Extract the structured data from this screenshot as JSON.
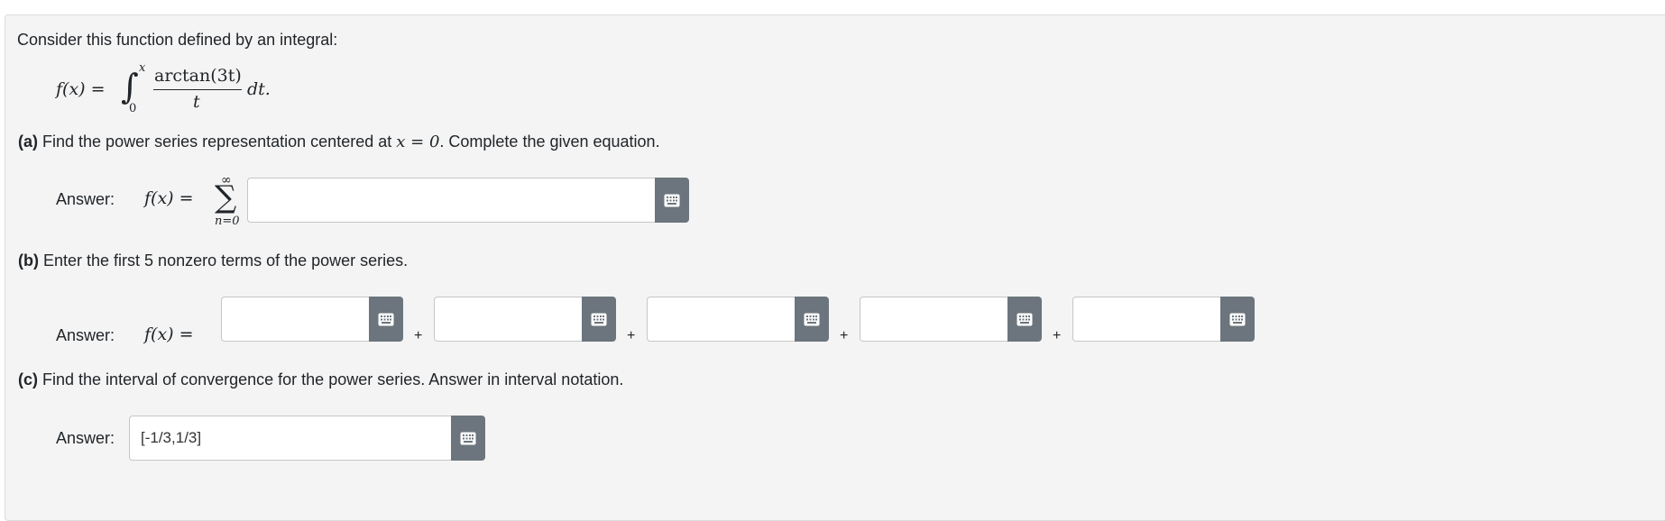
{
  "intro": "Consider this function defined by an integral:",
  "formula": {
    "lhs": "f(x) =",
    "upper": "x",
    "lower": "0",
    "numerator": "arctan(3t)",
    "denominator": "t",
    "differential": "dt."
  },
  "part_a": {
    "label": "(a)",
    "prompt_before": "Find the power series representation centered at",
    "condition": "x = 0",
    "prompt_after": ". Complete the given equation.",
    "answer_label": "Answer:",
    "lhs": "f(x) =",
    "sum_upper": "∞",
    "sum_lower": "n=0",
    "value": ""
  },
  "part_b": {
    "label": "(b)",
    "prompt": "Enter the first 5 nonzero terms of the power series.",
    "answer_label": "Answer:",
    "lhs": "f(x) =",
    "plus": "+",
    "terms": [
      "",
      "",
      "",
      "",
      ""
    ]
  },
  "part_c": {
    "label": "(c)",
    "prompt": "Find the interval of convergence for the power series. Answer in interval notation.",
    "answer_label": "Answer:",
    "value": "[-1/3,1/3]"
  },
  "colors": {
    "keyboard_button": "#6c757d",
    "panel": "#f4f4f4"
  },
  "icons": {
    "keyboard": "keyboard-icon"
  }
}
